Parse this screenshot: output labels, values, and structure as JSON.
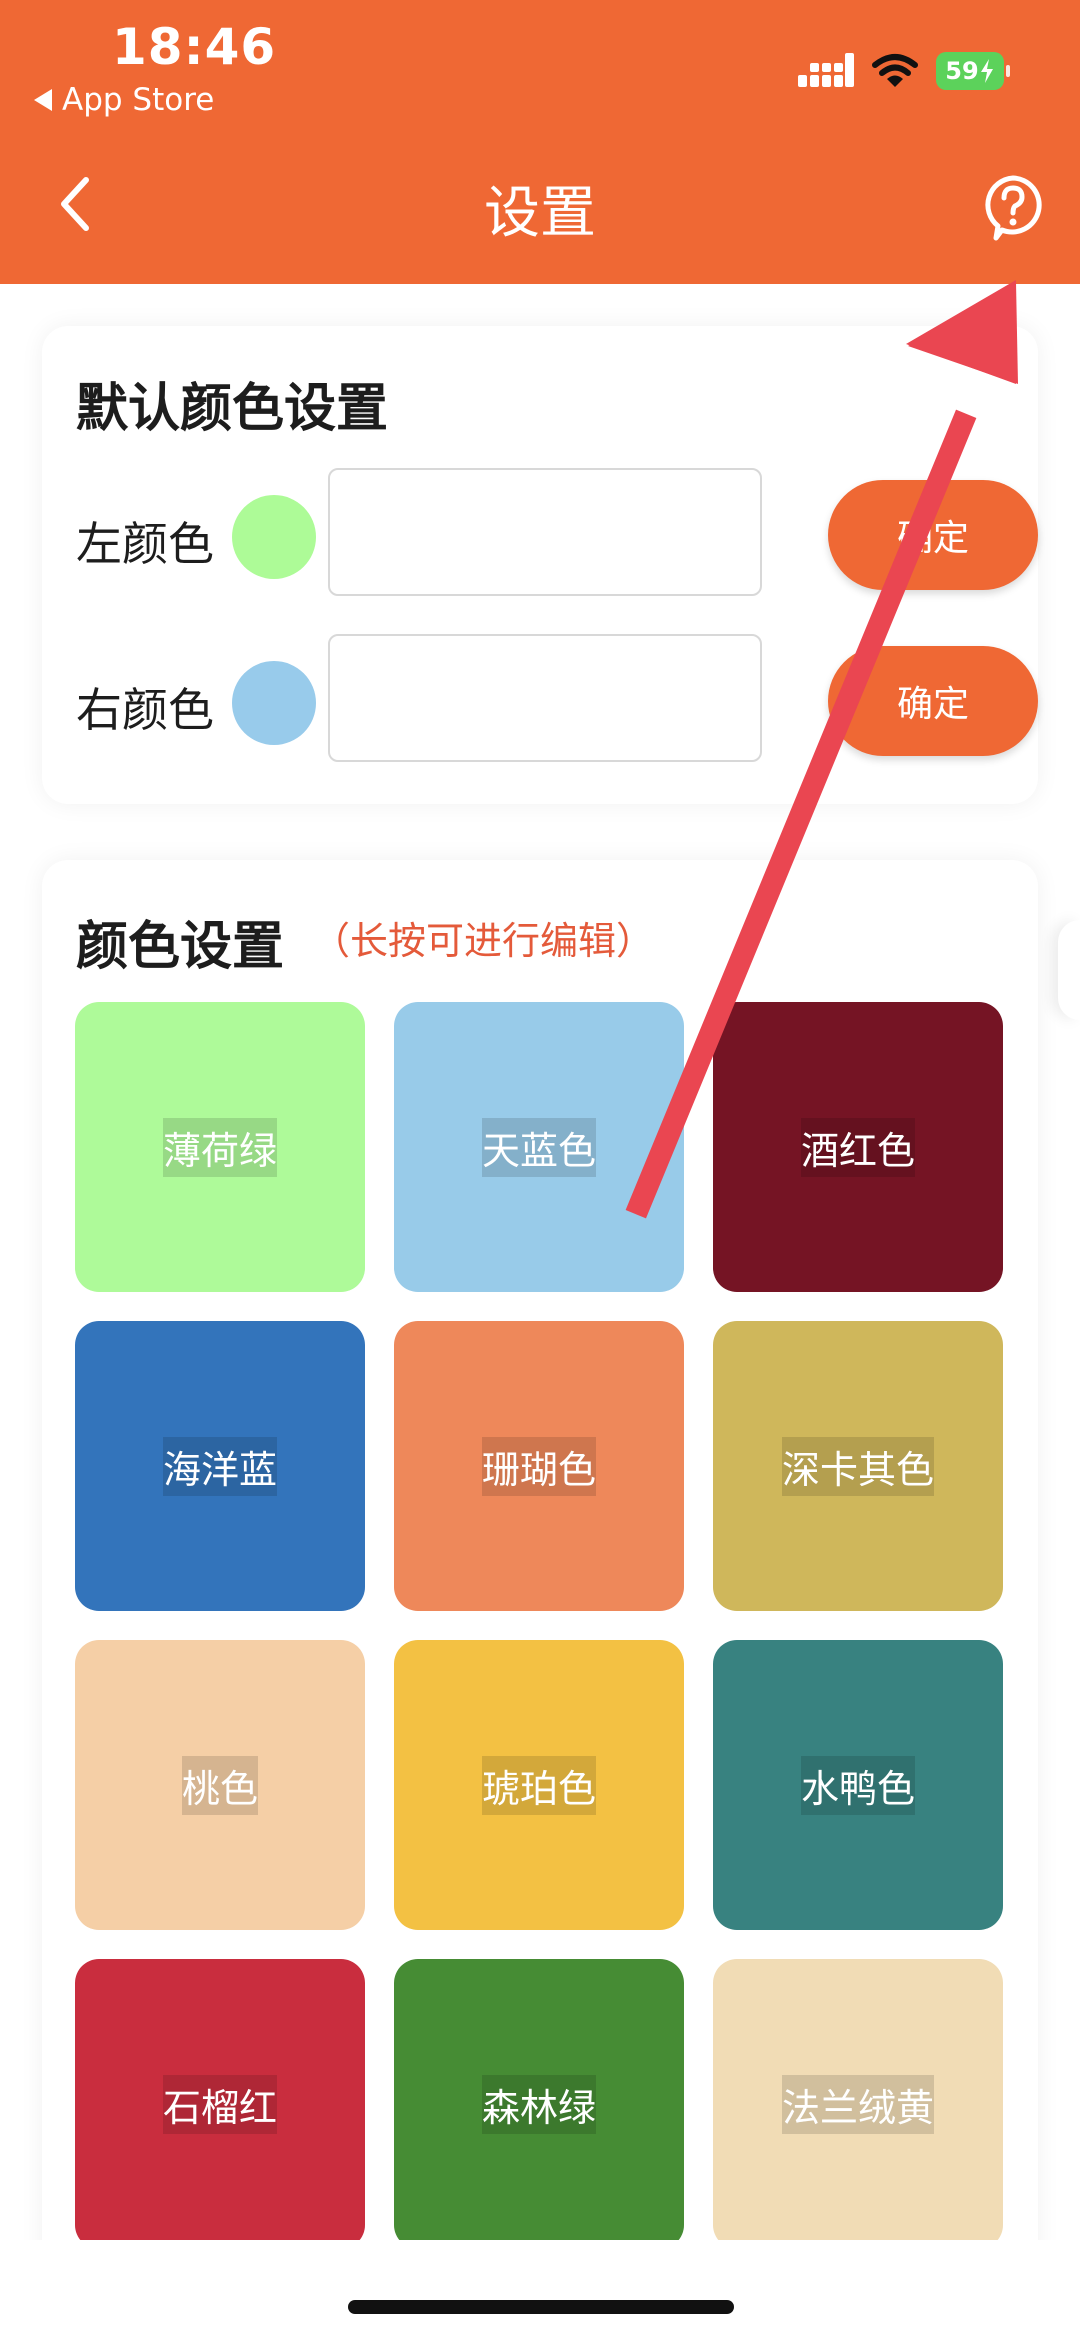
{
  "status_bar": {
    "time": "18:46",
    "back_app": "App Store",
    "battery": "59"
  },
  "header": {
    "title": "设置"
  },
  "default_colors": {
    "title": "默认颜色设置",
    "rows": [
      {
        "label": "左颜色",
        "swatch": "#adfb97",
        "value": "",
        "placeholder": "",
        "button": "确定"
      },
      {
        "label": "右颜色",
        "swatch": "#98cbeb",
        "value": "",
        "placeholder": "",
        "button": "确定"
      }
    ]
  },
  "color_settings": {
    "title": "颜色设置",
    "note": "（长按可进行编辑）",
    "tiles": [
      {
        "name": "薄荷绿",
        "color": "#aefa99"
      },
      {
        "name": "天蓝色",
        "color": "#98cbe9"
      },
      {
        "name": "酒红色",
        "color": "#751424"
      },
      {
        "name": "海洋蓝",
        "color": "#3374bb"
      },
      {
        "name": "珊瑚色",
        "color": "#ee885a"
      },
      {
        "name": "深卡其色",
        "color": "#cfb75b"
      },
      {
        "name": "桃色",
        "color": "#f5cfa6"
      },
      {
        "name": "琥珀色",
        "color": "#f3c143"
      },
      {
        "name": "水鸭色",
        "color": "#388280"
      },
      {
        "name": "石榴红",
        "color": "#c92d3e"
      },
      {
        "name": "森林绿",
        "color": "#468c34"
      },
      {
        "name": "法兰绒黄",
        "color": "#f1dcb5"
      }
    ]
  },
  "colors": {
    "accent": "#ef6834",
    "note": "#e45a3a",
    "annotation_arrow": "#ea4651"
  }
}
